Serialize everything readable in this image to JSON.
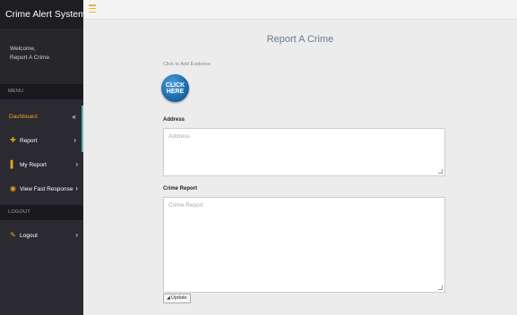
{
  "app": {
    "title": "Crime Alert System"
  },
  "welcome": {
    "line1": "Welcome,",
    "line2": "Report A Crime"
  },
  "sidebar": {
    "menu_header": "MENU",
    "logout_header": "LOGOUT",
    "items": [
      {
        "label": "Dashboard",
        "icon": "",
        "chevron": "«"
      },
      {
        "label": "Report",
        "icon": "plus-icon",
        "glyph": "✚",
        "chevron": "›"
      },
      {
        "label": "My Report",
        "icon": "file-icon",
        "glyph": "▌",
        "chevron": "›"
      },
      {
        "label": "View Fast Response",
        "icon": "eye-icon",
        "glyph": "◉",
        "chevron": "›"
      },
      {
        "label": "Logout",
        "icon": "edit-icon",
        "glyph": "✎",
        "chevron": "›"
      }
    ]
  },
  "main": {
    "title": "Report A Crime",
    "evidence_label": "Click to Add Evidence",
    "click_here_text": "CLICK HERE",
    "address_label": "Address",
    "address_placeholder": "Address",
    "crime_report_label": "Crime Report",
    "crime_report_placeholder": "Crime Report",
    "update_button": "Update"
  },
  "colors": {
    "accent": "#e8a41b",
    "sidebar_bg": "#2a2a30",
    "active_border": "#5fb5b1"
  }
}
